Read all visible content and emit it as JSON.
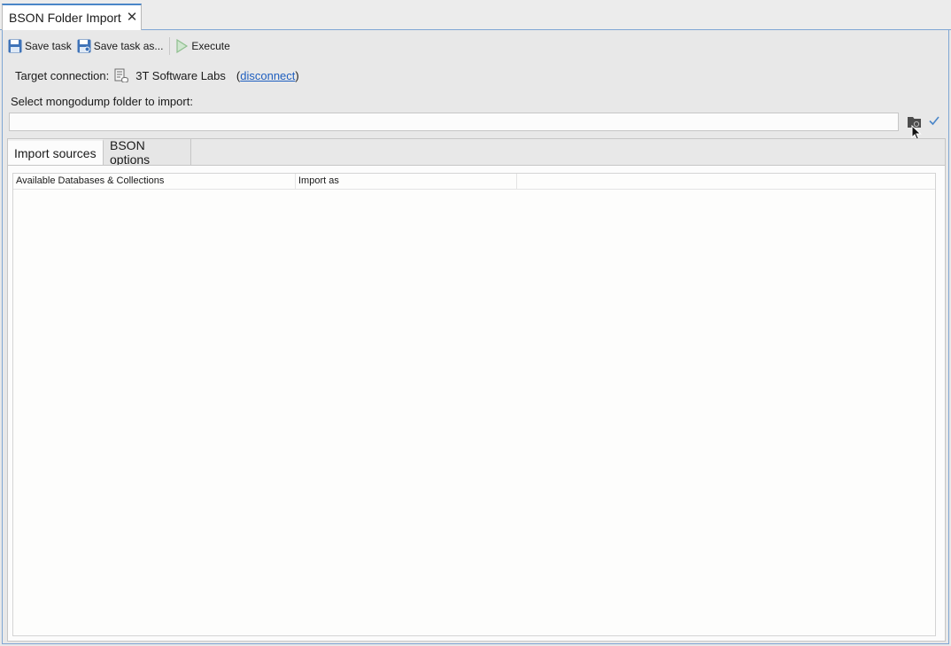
{
  "window": {
    "tab_title": "BSON Folder Import"
  },
  "toolbar": {
    "save_task": "Save task",
    "save_task_as": "Save task as...",
    "execute": "Execute"
  },
  "connection": {
    "label": "Target connection:",
    "name": "3T Software Labs",
    "open_paren": "(",
    "disconnect": "disconnect",
    "close_paren": ")"
  },
  "folder": {
    "label": "Select mongodump folder to import:",
    "value": ""
  },
  "tabs": [
    {
      "label": "Import sources",
      "active": true
    },
    {
      "label": "BSON options",
      "active": false
    }
  ],
  "table": {
    "columns": [
      "Available Databases & Collections",
      "Import as",
      ""
    ],
    "rows": []
  },
  "colors": {
    "accent": "#4a86c8",
    "link": "#1f5fbf",
    "save_icon": "#3f73b8",
    "execute_icon": "#8fbf8f"
  },
  "icons": [
    "close-icon",
    "floppy-disk-icon",
    "floppy-disk-as-icon",
    "play-icon",
    "connection-icon",
    "folder-icon",
    "checkmark-icon",
    "mouse-pointer-icon"
  ]
}
